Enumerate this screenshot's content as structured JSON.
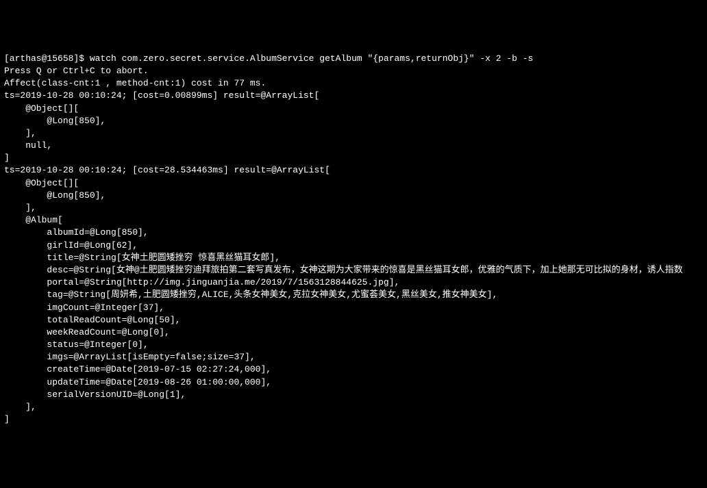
{
  "prompt": {
    "user_host": "[arthas@15658]$ ",
    "command": "watch com.zero.secret.service.AlbumService getAlbum \"{params,returnObj}\" -x 2 -b -s"
  },
  "lines": {
    "l01": "Press Q or Ctrl+C to abort.",
    "l02": "Affect(class-cnt:1 , method-cnt:1) cost in 77 ms.",
    "l03": "ts=2019-10-28 00:10:24; [cost=0.00899ms] result=@ArrayList[",
    "l04": "    @Object[][",
    "l05": "        @Long[850],",
    "l06": "    ],",
    "l07": "    null,",
    "l08": "]",
    "l09": "ts=2019-10-28 00:10:24; [cost=28.534463ms] result=@ArrayList[",
    "l10": "    @Object[][",
    "l11": "        @Long[850],",
    "l12": "    ],",
    "l13": "    @Album[",
    "l14": "        albumId=@Long[850],",
    "l15": "        girlId=@Long[62],",
    "l16": "        title=@String[女神土肥圆矮挫穷 惊喜黑丝猫耳女郎],",
    "l17": "        desc=@String[女神@土肥圆矮挫穷迪拜旅拍第二套写真发布，女神这期为大家带来的惊喜是黑丝猫耳女郎，优雅的气质下，加上她那无可比拟的身材，诱人指数",
    "l18": "        portal=@String[http://img.jinguanjia.me/2019/7/1563128844625.jpg],",
    "l19": "        tag=@String[周妍希,土肥圆矮挫穷,ALICE,头条女神美女,克拉女神美女,尤蜜荟美女,黑丝美女,推女神美女],",
    "l20": "        imgCount=@Integer[37],",
    "l21": "        totalReadCount=@Long[50],",
    "l22": "        weekReadCount=@Long[0],",
    "l23": "        status=@Integer[0],",
    "l24": "        imgs=@ArrayList[isEmpty=false;size=37],",
    "l25": "        createTime=@Date[2019-07-15 02:27:24,000],",
    "l26": "        updateTime=@Date[2019-08-26 01:00:00,000],",
    "l27": "        serialVersionUID=@Long[1],",
    "l28": "    ],",
    "l29": "]"
  }
}
